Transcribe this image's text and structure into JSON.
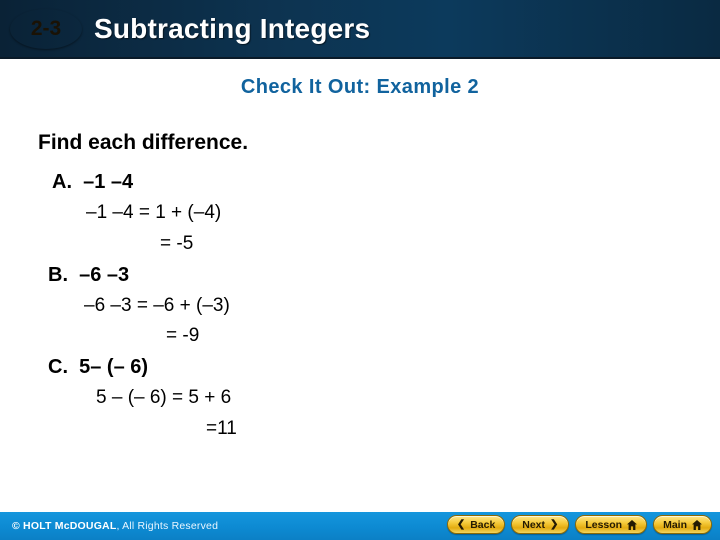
{
  "header": {
    "badge": "2-3",
    "title": "Subtracting Integers"
  },
  "subtitle": "Check It Out: Example 2",
  "content": {
    "prompt": "Find each difference.",
    "parts": [
      {
        "label": "A.  –1 –4",
        "lines": [
          "–1 –4 = 1 + (–4)",
          "= -5"
        ]
      },
      {
        "label": "B.  –6 –3",
        "lines": [
          "–6 –3 = –6 + (–3)",
          "= -9"
        ]
      },
      {
        "label": "C.  5– (– 6)",
        "lines": [
          "5 – (– 6) = 5 + 6",
          "=11"
        ]
      }
    ]
  },
  "footer": {
    "copyright_bold": "© HOLT McDOUGAL",
    "copyright_rest": ", All Rights Reserved",
    "buttons": [
      {
        "label": "Back",
        "icon": "chevron-left-icon",
        "glyph": "❮"
      },
      {
        "label": "Next",
        "icon": "chevron-right-icon",
        "glyph": "❯"
      },
      {
        "label": "Lesson",
        "icon": "home-icon",
        "glyph": ""
      },
      {
        "label": "Main",
        "icon": "home-icon",
        "glyph": ""
      }
    ]
  },
  "colors": {
    "header_bg": "#0d3350",
    "badge": "#f2c033",
    "subtitle": "#11639e",
    "footer_bg": "#0d8ad2",
    "button": "#f6cc3e"
  }
}
